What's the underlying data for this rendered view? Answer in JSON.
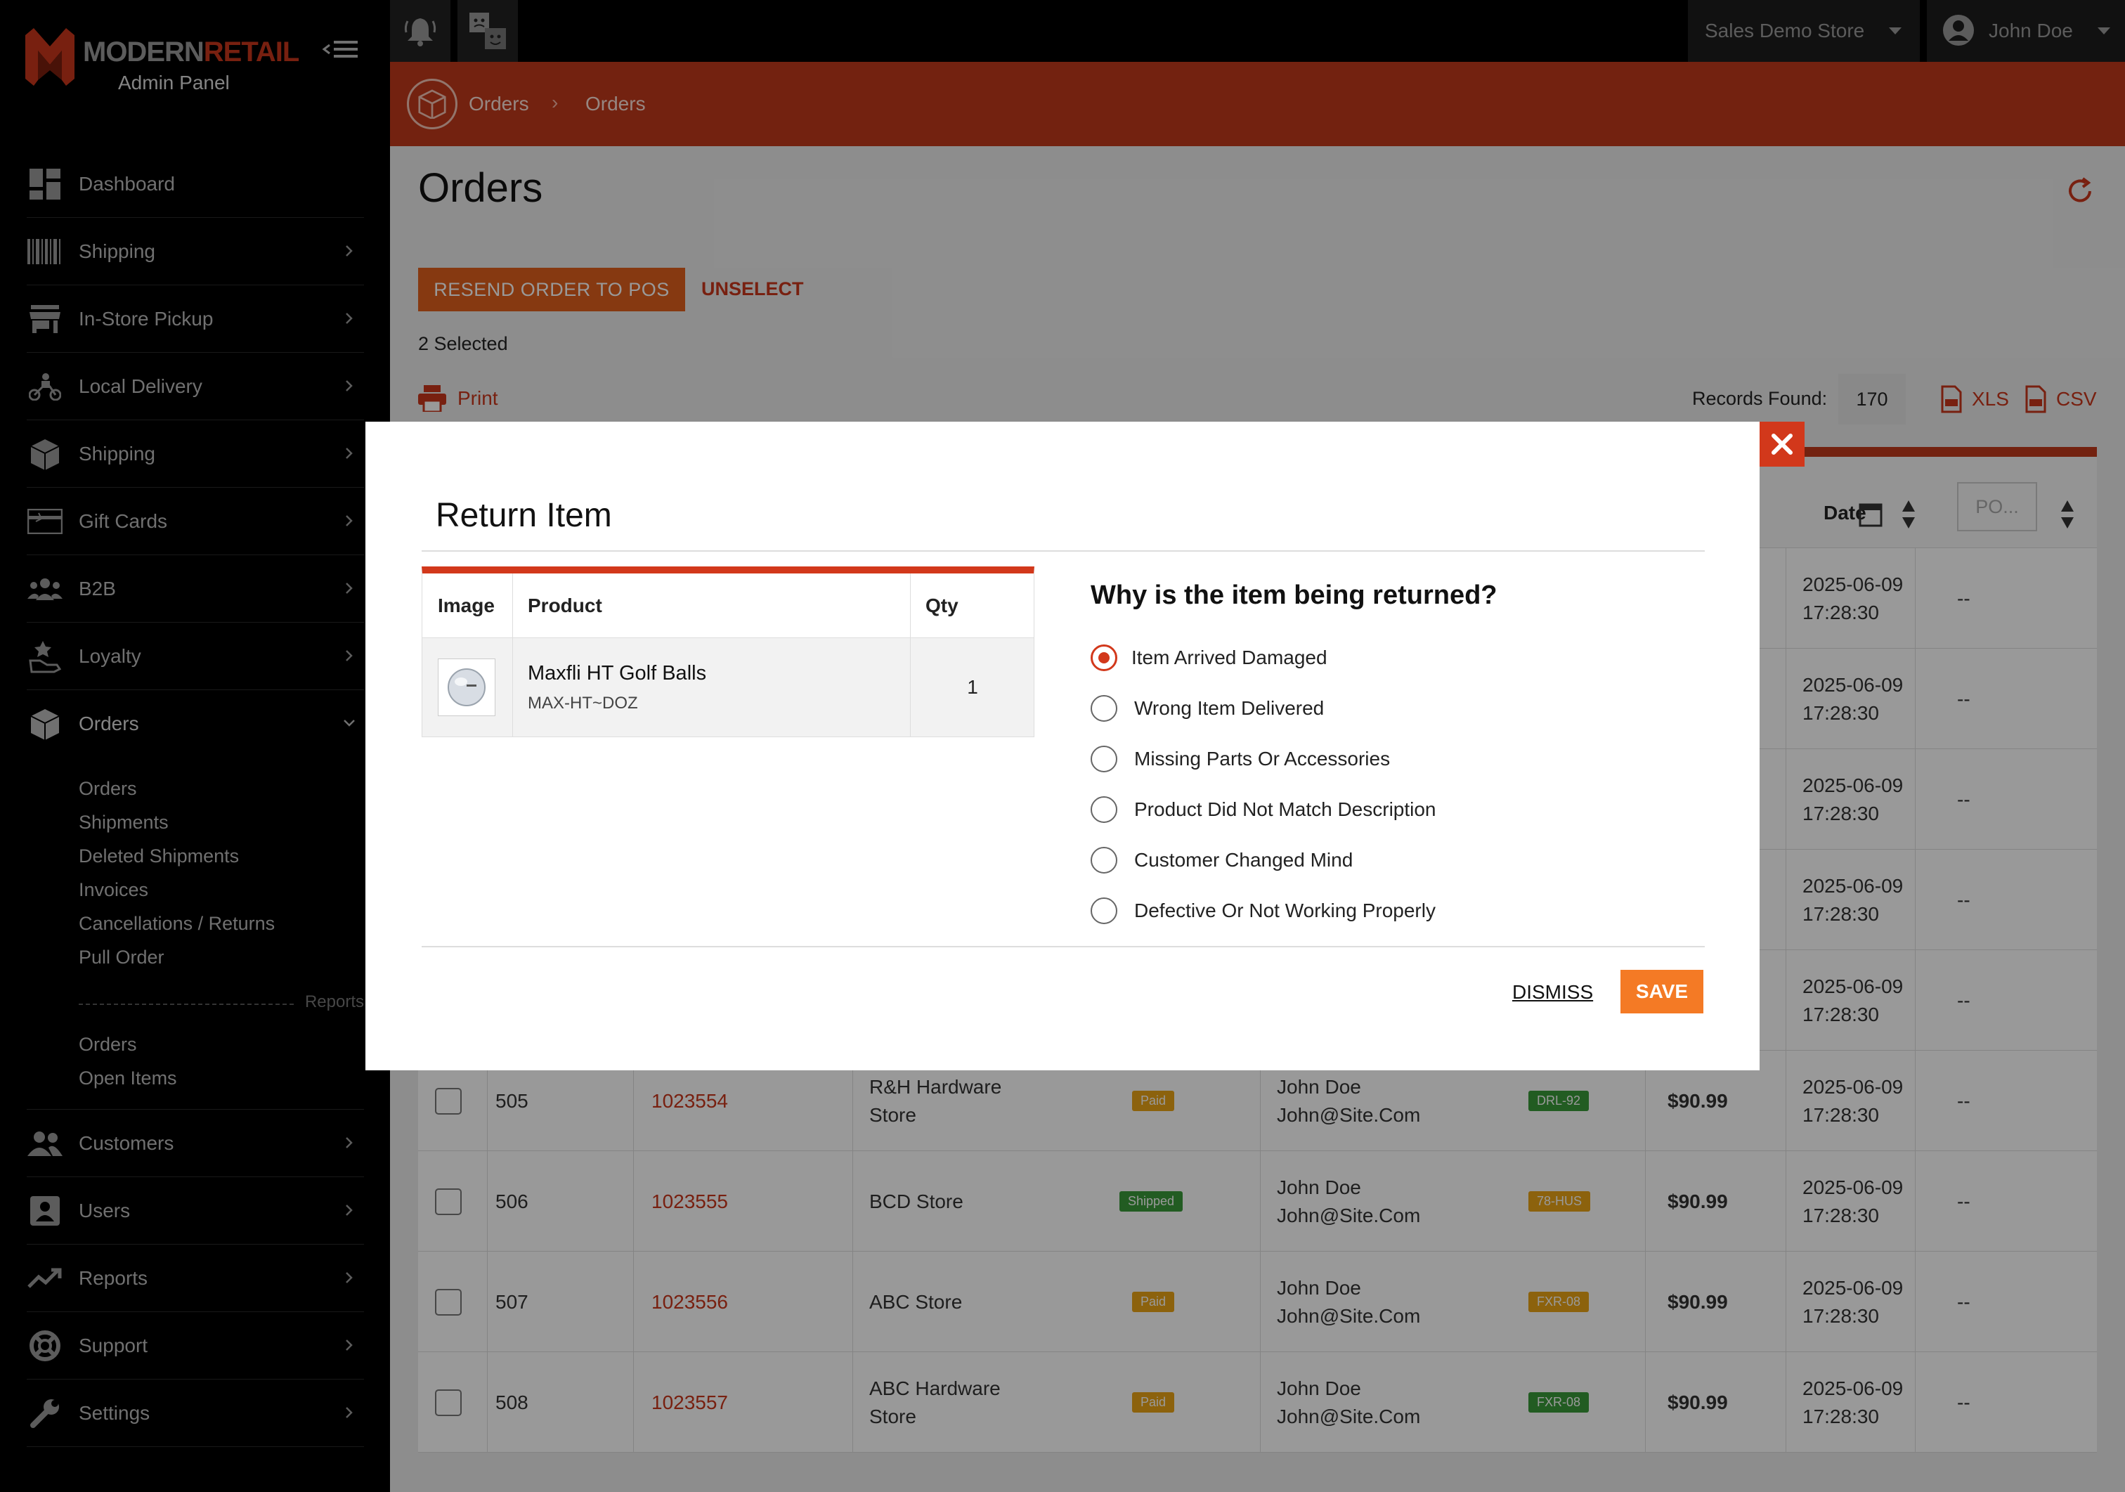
{
  "brand": {
    "name_part1": "MODERN",
    "name_part2": "RETAIL",
    "subtitle": "Admin Panel"
  },
  "sidebar": {
    "items": [
      {
        "label": "Dashboard",
        "icon": "dashboard-icon"
      },
      {
        "label": "Shipping",
        "icon": "barcode-icon"
      },
      {
        "label": "In-Store Pickup",
        "icon": "store-icon"
      },
      {
        "label": "Local Delivery",
        "icon": "scooter-icon"
      },
      {
        "label": "Shipping",
        "icon": "box-icon"
      },
      {
        "label": "Gift Cards",
        "icon": "gift-card-icon"
      },
      {
        "label": "B2B",
        "icon": "group-icon"
      },
      {
        "label": "Loyalty",
        "icon": "loyalty-icon"
      },
      {
        "label": "Orders",
        "icon": "box-icon"
      }
    ],
    "orders_sub": [
      "Orders",
      "Shipments",
      "Deleted Shipments",
      "Invoices",
      "Cancellations / Returns",
      "Pull Order"
    ],
    "reports_divider": "Reports",
    "reports_sub": [
      "Orders",
      "Open Items"
    ],
    "items_bottom": [
      {
        "label": "Customers",
        "icon": "people-icon"
      },
      {
        "label": "Users",
        "icon": "user-icon"
      },
      {
        "label": "Reports",
        "icon": "trend-icon"
      },
      {
        "label": "Support",
        "icon": "lifebuoy-icon"
      },
      {
        "label": "Settings",
        "icon": "wrench-icon"
      }
    ]
  },
  "topbar": {
    "store": "Sales Demo Store",
    "user": "John Doe"
  },
  "breadcrumb": [
    "Orders",
    "Orders"
  ],
  "page": {
    "title": "Orders",
    "resend_label": "RESEND ORDER TO POS",
    "unselect_label": "UNSELECT",
    "selected_text": "2 Selected",
    "print_label": "Print",
    "records_label": "Records Found:",
    "records_count": "170",
    "xls_label": "XLS",
    "csv_label": "CSV"
  },
  "table": {
    "date_header": "Date",
    "po_placeholder": "PO...",
    "hidden_dates": [
      "2025-06-09",
      "2025-06-09",
      "2025-06-09",
      "2025-06-09",
      "2025-06-09"
    ],
    "hidden_time": "17:28:30",
    "rows": [
      {
        "num": "505",
        "order": "1023554",
        "store_line1": "R&H Hardware",
        "store_line2": "Store",
        "status": "Paid",
        "status_color": "#e9a317",
        "customer": "John Doe",
        "email": "John@Site.Com",
        "tag": "DRL-92",
        "tag_color": "#3a9a3a",
        "price": "$90.99",
        "date": "2025-06-09",
        "time": "17:28:30",
        "po": "--"
      },
      {
        "num": "506",
        "order": "1023555",
        "store_line1": "BCD Store",
        "store_line2": "",
        "status": "Shipped",
        "status_color": "#3a9a3a",
        "customer": "John Doe",
        "email": "John@Site.Com",
        "tag": "78-HUS",
        "tag_color": "#e9a317",
        "price": "$90.99",
        "date": "2025-06-09",
        "time": "17:28:30",
        "po": "--"
      },
      {
        "num": "507",
        "order": "1023556",
        "store_line1": "ABC Store",
        "store_line2": "",
        "status": "Paid",
        "status_color": "#e9a317",
        "customer": "John Doe",
        "email": "John@Site.Com",
        "tag": "FXR-08",
        "tag_color": "#e9a317",
        "price": "$90.99",
        "date": "2025-06-09",
        "time": "17:28:30",
        "po": "--"
      },
      {
        "num": "508",
        "order": "1023557",
        "store_line1": "ABC Hardware",
        "store_line2": "Store",
        "status": "Paid",
        "status_color": "#e9a317",
        "customer": "John Doe",
        "email": "John@Site.Com",
        "tag": "FXR-08",
        "tag_color": "#3a9a3a",
        "price": "$90.99",
        "date": "2025-06-09",
        "time": "17:28:30",
        "po": "--"
      }
    ]
  },
  "modal": {
    "title": "Return Item",
    "table_headers": {
      "image": "Image",
      "product": "Product",
      "qty": "Qty"
    },
    "item": {
      "name": "Maxfli HT Golf Balls",
      "sku": "MAX-HT~DOZ",
      "qty": "1"
    },
    "question": "Why is the item being returned?",
    "reasons": [
      "Item Arrived Damaged",
      "Wrong Item Delivered",
      "Missing Parts Or Accessories",
      "Product Did Not Match Description",
      "Customer Changed Mind",
      "Defective Or Not Working Properly"
    ],
    "selected_reason": "Item Arrived Damaged",
    "dismiss_label": "DISMISS",
    "save_label": "SAVE"
  },
  "colors": {
    "brand_red": "#c0391b",
    "accent_orange": "#f47a25",
    "sidebar_bg": "#000000"
  }
}
